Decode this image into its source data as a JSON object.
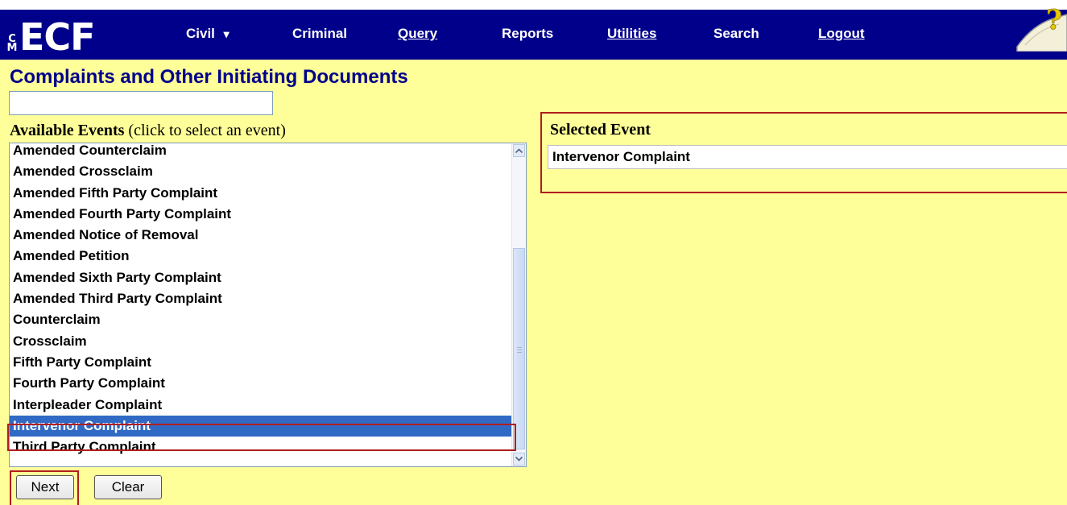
{
  "app": {
    "logo_small": "CM",
    "logo_main": "ECF"
  },
  "nav": {
    "items": [
      {
        "id": "civil",
        "label": "Civil",
        "has_dropdown": true
      },
      {
        "id": "criminal",
        "label": "Criminal"
      },
      {
        "id": "query",
        "label": "Query"
      },
      {
        "id": "reports",
        "label": "Reports"
      },
      {
        "id": "utilities",
        "label": "Utilities"
      },
      {
        "id": "search",
        "label": "Search"
      },
      {
        "id": "logout",
        "label": "Logout"
      }
    ],
    "dropdown_glyph": "▾",
    "help_icon": "help-question-icon"
  },
  "page": {
    "title": "Complaints and Other Initiating Documents",
    "search_value": ""
  },
  "available": {
    "label_bold": "Available Events",
    "label_note": " (click to select an event)",
    "items": [
      "Amended Counterclaim",
      "Amended Crossclaim",
      "Amended Fifth Party Complaint",
      "Amended Fourth Party Complaint",
      "Amended Notice of Removal",
      "Amended Petition",
      "Amended Sixth Party Complaint",
      "Amended Third Party Complaint",
      "Counterclaim",
      "Crossclaim",
      "Fifth Party Complaint",
      "Fourth Party Complaint",
      "Interpleader Complaint",
      "Intervenor Complaint",
      "Third Party Complaint"
    ],
    "selected_index": 13
  },
  "selected": {
    "label": "Selected Event",
    "value": "Intervenor Complaint"
  },
  "buttons": {
    "next": "Next",
    "clear": "Clear"
  },
  "colors": {
    "nav_bg": "#00008b",
    "page_bg": "#ffff99",
    "highlight": "#b01e1e",
    "selection": "#316ac5"
  }
}
